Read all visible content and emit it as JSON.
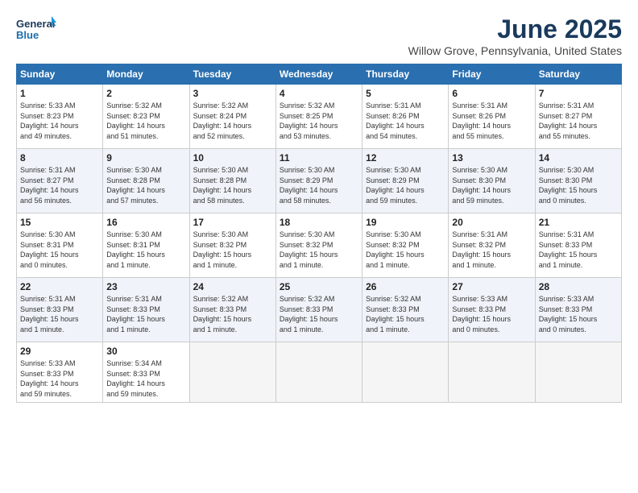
{
  "logo": {
    "line1": "General",
    "line2": "Blue"
  },
  "title": "June 2025",
  "subtitle": "Willow Grove, Pennsylvania, United States",
  "days_of_week": [
    "Sunday",
    "Monday",
    "Tuesday",
    "Wednesday",
    "Thursday",
    "Friday",
    "Saturday"
  ],
  "weeks": [
    [
      {
        "day": "1",
        "text": "Sunrise: 5:33 AM\nSunset: 8:23 PM\nDaylight: 14 hours\nand 49 minutes."
      },
      {
        "day": "2",
        "text": "Sunrise: 5:32 AM\nSunset: 8:23 PM\nDaylight: 14 hours\nand 51 minutes."
      },
      {
        "day": "3",
        "text": "Sunrise: 5:32 AM\nSunset: 8:24 PM\nDaylight: 14 hours\nand 52 minutes."
      },
      {
        "day": "4",
        "text": "Sunrise: 5:32 AM\nSunset: 8:25 PM\nDaylight: 14 hours\nand 53 minutes."
      },
      {
        "day": "5",
        "text": "Sunrise: 5:31 AM\nSunset: 8:26 PM\nDaylight: 14 hours\nand 54 minutes."
      },
      {
        "day": "6",
        "text": "Sunrise: 5:31 AM\nSunset: 8:26 PM\nDaylight: 14 hours\nand 55 minutes."
      },
      {
        "day": "7",
        "text": "Sunrise: 5:31 AM\nSunset: 8:27 PM\nDaylight: 14 hours\nand 55 minutes."
      }
    ],
    [
      {
        "day": "8",
        "text": "Sunrise: 5:31 AM\nSunset: 8:27 PM\nDaylight: 14 hours\nand 56 minutes."
      },
      {
        "day": "9",
        "text": "Sunrise: 5:30 AM\nSunset: 8:28 PM\nDaylight: 14 hours\nand 57 minutes."
      },
      {
        "day": "10",
        "text": "Sunrise: 5:30 AM\nSunset: 8:28 PM\nDaylight: 14 hours\nand 58 minutes."
      },
      {
        "day": "11",
        "text": "Sunrise: 5:30 AM\nSunset: 8:29 PM\nDaylight: 14 hours\nand 58 minutes."
      },
      {
        "day": "12",
        "text": "Sunrise: 5:30 AM\nSunset: 8:29 PM\nDaylight: 14 hours\nand 59 minutes."
      },
      {
        "day": "13",
        "text": "Sunrise: 5:30 AM\nSunset: 8:30 PM\nDaylight: 14 hours\nand 59 minutes."
      },
      {
        "day": "14",
        "text": "Sunrise: 5:30 AM\nSunset: 8:30 PM\nDaylight: 15 hours\nand 0 minutes."
      }
    ],
    [
      {
        "day": "15",
        "text": "Sunrise: 5:30 AM\nSunset: 8:31 PM\nDaylight: 15 hours\nand 0 minutes."
      },
      {
        "day": "16",
        "text": "Sunrise: 5:30 AM\nSunset: 8:31 PM\nDaylight: 15 hours\nand 1 minute."
      },
      {
        "day": "17",
        "text": "Sunrise: 5:30 AM\nSunset: 8:32 PM\nDaylight: 15 hours\nand 1 minute."
      },
      {
        "day": "18",
        "text": "Sunrise: 5:30 AM\nSunset: 8:32 PM\nDaylight: 15 hours\nand 1 minute."
      },
      {
        "day": "19",
        "text": "Sunrise: 5:30 AM\nSunset: 8:32 PM\nDaylight: 15 hours\nand 1 minute."
      },
      {
        "day": "20",
        "text": "Sunrise: 5:31 AM\nSunset: 8:32 PM\nDaylight: 15 hours\nand 1 minute."
      },
      {
        "day": "21",
        "text": "Sunrise: 5:31 AM\nSunset: 8:33 PM\nDaylight: 15 hours\nand 1 minute."
      }
    ],
    [
      {
        "day": "22",
        "text": "Sunrise: 5:31 AM\nSunset: 8:33 PM\nDaylight: 15 hours\nand 1 minute."
      },
      {
        "day": "23",
        "text": "Sunrise: 5:31 AM\nSunset: 8:33 PM\nDaylight: 15 hours\nand 1 minute."
      },
      {
        "day": "24",
        "text": "Sunrise: 5:32 AM\nSunset: 8:33 PM\nDaylight: 15 hours\nand 1 minute."
      },
      {
        "day": "25",
        "text": "Sunrise: 5:32 AM\nSunset: 8:33 PM\nDaylight: 15 hours\nand 1 minute."
      },
      {
        "day": "26",
        "text": "Sunrise: 5:32 AM\nSunset: 8:33 PM\nDaylight: 15 hours\nand 1 minute."
      },
      {
        "day": "27",
        "text": "Sunrise: 5:33 AM\nSunset: 8:33 PM\nDaylight: 15 hours\nand 0 minutes."
      },
      {
        "day": "28",
        "text": "Sunrise: 5:33 AM\nSunset: 8:33 PM\nDaylight: 15 hours\nand 0 minutes."
      }
    ],
    [
      {
        "day": "29",
        "text": "Sunrise: 5:33 AM\nSunset: 8:33 PM\nDaylight: 14 hours\nand 59 minutes."
      },
      {
        "day": "30",
        "text": "Sunrise: 5:34 AM\nSunset: 8:33 PM\nDaylight: 14 hours\nand 59 minutes."
      },
      {
        "day": "",
        "text": ""
      },
      {
        "day": "",
        "text": ""
      },
      {
        "day": "",
        "text": ""
      },
      {
        "day": "",
        "text": ""
      },
      {
        "day": "",
        "text": ""
      }
    ]
  ]
}
